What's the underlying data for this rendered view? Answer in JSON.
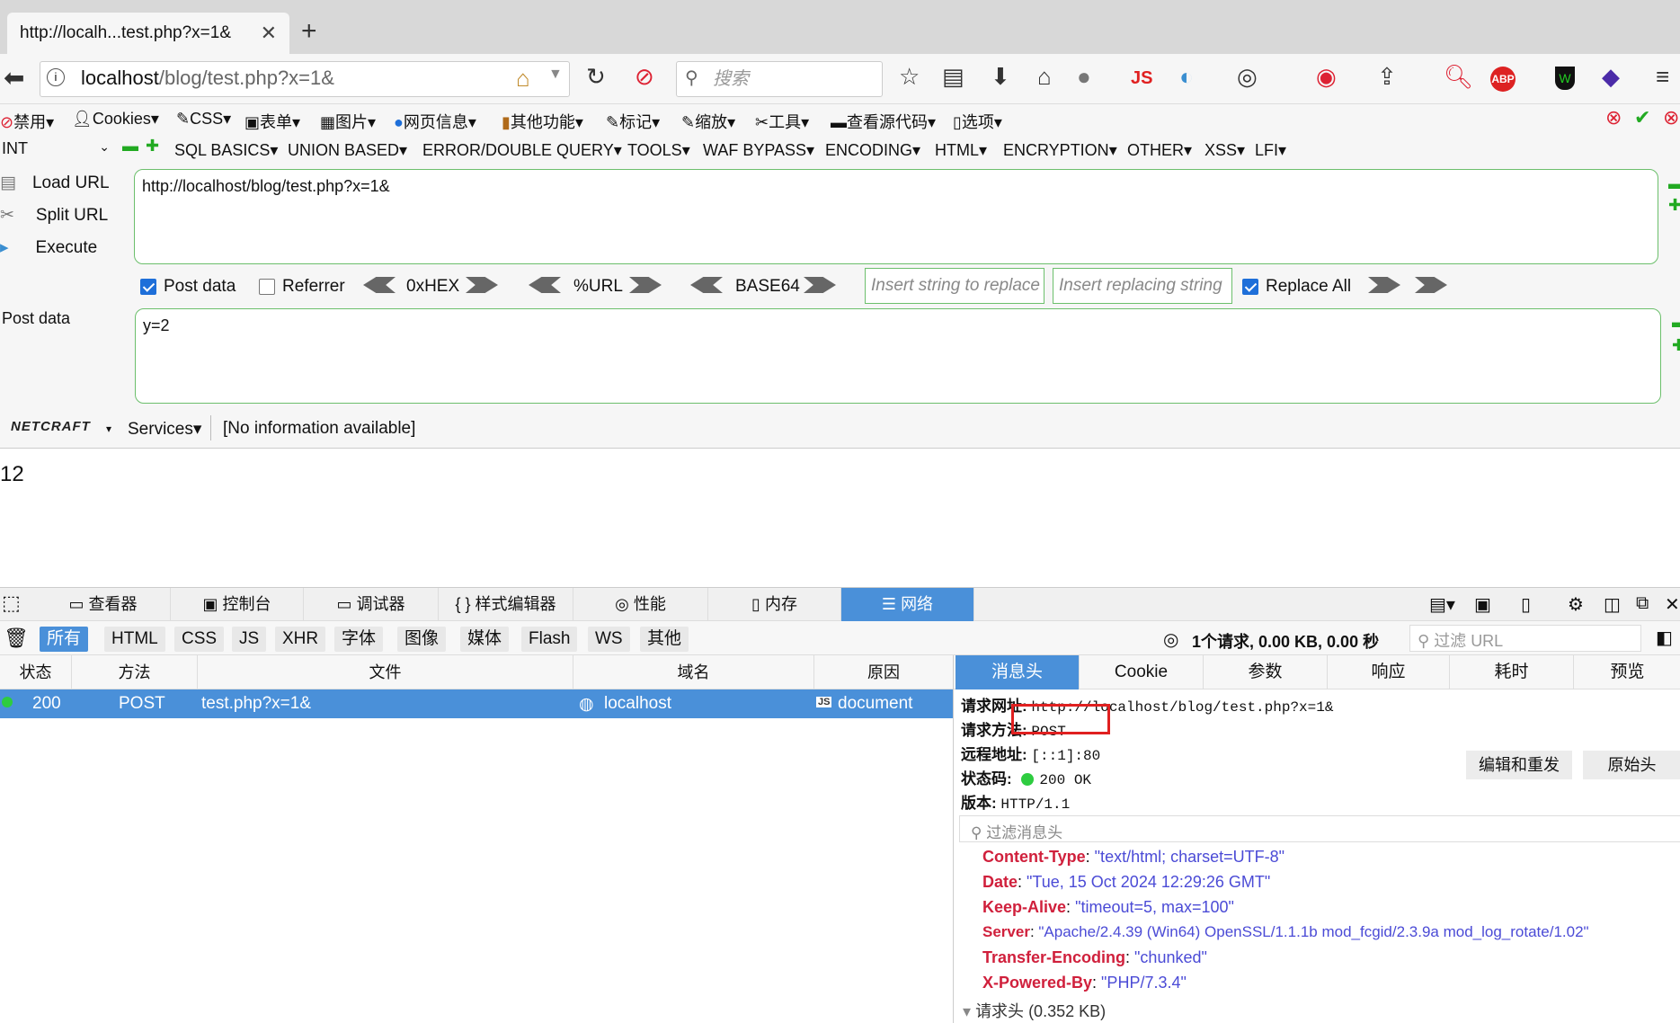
{
  "browser": {
    "tab_title": "http://localh...test.php?x=1&",
    "url_host": "localhost",
    "url_path": "/blog/test.php?x=1&",
    "search_placeholder": "搜索",
    "js_badge": "JS"
  },
  "menubar": {
    "items": [
      "禁用",
      "Cookies",
      "CSS",
      "表单",
      "图片",
      "网页信息",
      "其他功能",
      "标记",
      "缩放",
      "工具",
      "查看源代码",
      "选项"
    ]
  },
  "hackbar": {
    "select_value": "INT",
    "menu": [
      "SQL BASICS",
      "UNION BASED",
      "ERROR/DOUBLE QUERY",
      "TOOLS",
      "WAF BYPASS",
      "ENCODING",
      "HTML",
      "ENCRYPTION",
      "OTHER",
      "XSS",
      "LFI"
    ],
    "load_url": "Load URL",
    "split_url": "Split URL",
    "execute": "Execute",
    "url_value": "http://localhost/blog/test.php?x=1&",
    "post_data_checkbox": "Post data",
    "referrer_checkbox": "Referrer",
    "hex": "0xHEX",
    "url_enc": "%URL",
    "base64": "BASE64",
    "insert_replace_placeholder": "Insert string to replace",
    "insert_replacing_placeholder": "Insert replacing string",
    "replace_all": "Replace All",
    "post_data_label": "Post data",
    "post_data_value": "y=2",
    "netcraft": "NETCRAFT",
    "services": "Services",
    "netcraft_info": "[No information available]"
  },
  "page": {
    "content": "12"
  },
  "devtools": {
    "tabs": [
      "查看器",
      "控制台",
      "调试器",
      "样式编辑器",
      "性能",
      "内存",
      "网络"
    ],
    "filters": [
      "所有",
      "HTML",
      "CSS",
      "JS",
      "XHR",
      "字体",
      "图像",
      "媒体",
      "Flash",
      "WS",
      "其他"
    ],
    "summary": "1个请求, 0.00 KB, 0.00 秒",
    "filter_url_placeholder": "过滤 URL",
    "columns": [
      "状态",
      "方法",
      "文件",
      "域名",
      "原因"
    ],
    "request": {
      "status": "200",
      "method": "POST",
      "file": "test.php?x=1&",
      "domain": "localhost",
      "cause": "document"
    },
    "detail_tabs": [
      "消息头",
      "Cookie",
      "参数",
      "响应",
      "耗时",
      "预览"
    ],
    "summary_rows": {
      "url_label": "请求网址:",
      "url_value": "http://localhost/blog/test.php?x=1&",
      "method_label": "请求方法:",
      "method_value": "POST",
      "remote_label": "远程地址:",
      "remote_value": "[::1]:80",
      "status_label": "状态码:",
      "status_value": "200 OK",
      "version_label": "版本:",
      "version_value": "HTTP/1.1"
    },
    "edit_resend": "编辑和重发",
    "raw_headers": "原始头",
    "filter_headers_placeholder": "过滤消息头",
    "response_headers": [
      {
        "k": "Content-Type",
        "v": "\"text/html; charset=UTF-8\""
      },
      {
        "k": "Date",
        "v": "\"Tue, 15 Oct 2024 12:29:26 GMT\""
      },
      {
        "k": "Keep-Alive",
        "v": "\"timeout=5, max=100\""
      },
      {
        "k": "Server",
        "v": "\"Apache/2.4.39 (Win64) OpenSSL/1.1.1b mod_fcgid/2.3.9a mod_log_rotate/1.02\""
      },
      {
        "k": "Transfer-Encoding",
        "v": "\"chunked\""
      },
      {
        "k": "X-Powered-By",
        "v": "\"PHP/7.3.4\""
      }
    ],
    "request_headers_label": "请求头 (0.352 KB)",
    "colors": {
      "accent": "#4a90d9",
      "header_key": "#d0203c",
      "header_value": "#4b4bd6",
      "status_ok": "#2ecc40",
      "highlight_box": "#e02020"
    }
  }
}
